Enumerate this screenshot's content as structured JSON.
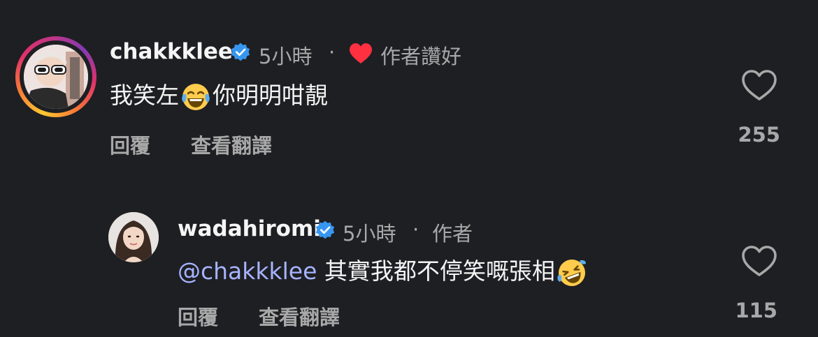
{
  "comments": [
    {
      "username": "chakkklee",
      "time": "5小時",
      "separator": "·",
      "badge": "作者讚好",
      "text_before": "我笑左",
      "text_after": "你明明咁靚",
      "reply_label": "回覆",
      "translate_label": "查看翻譯",
      "likes": "255"
    },
    {
      "username": "wadahiromi",
      "time": "5小時",
      "separator": "·",
      "badge": "作者",
      "mention": "@chakkklee",
      "text": "其實我都不停笑嘅張相",
      "reply_label": "回覆",
      "translate_label": "查看翻譯",
      "likes": "115"
    }
  ],
  "colors": {
    "background": "#1e1f23",
    "text": "#f5f5f5",
    "muted": "#a8a8a8",
    "mention": "#a7b4ff",
    "verified": "#3797f0",
    "liked_heart": "#ff3040"
  }
}
